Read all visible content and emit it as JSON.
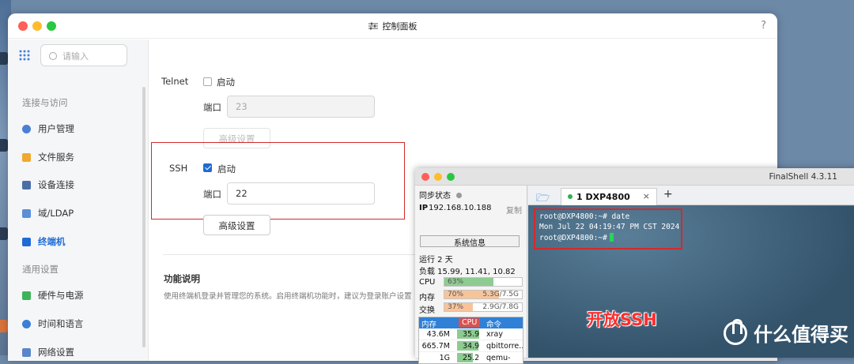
{
  "window": {
    "title": "控制面板",
    "help": "?"
  },
  "sidebar": {
    "search_placeholder": "请输入",
    "section1": "连接与访问",
    "section2": "通用设置",
    "items": [
      {
        "label": "用户管理",
        "icon": "user-icon"
      },
      {
        "label": "文件服务",
        "icon": "folder-icon"
      },
      {
        "label": "设备连接",
        "icon": "device-icon"
      },
      {
        "label": "域/LDAP",
        "icon": "domain-icon"
      },
      {
        "label": "终端机",
        "icon": "terminal-icon",
        "active": true
      },
      {
        "label": "硬件与电源",
        "icon": "battery-icon"
      },
      {
        "label": "时间和语言",
        "icon": "clock-icon"
      },
      {
        "label": "网络设置",
        "icon": "network-icon"
      }
    ]
  },
  "telnet": {
    "label": "Telnet",
    "enable": "启动",
    "enabled": false,
    "port_label": "端口",
    "port": "23",
    "advanced": "高级设置"
  },
  "ssh": {
    "label": "SSH",
    "enable": "启动",
    "enabled": true,
    "port_label": "端口",
    "port": "22",
    "advanced": "高级设置"
  },
  "func": {
    "title": "功能说明",
    "desc": "使用终端机登录并管理您的系统。启用终端机功能时，建议为登录账户设置"
  },
  "finalshell": {
    "app_name": "FinalShell 4.3.11",
    "sync_status": "同步状态",
    "ip_label": "IP",
    "ip": "192.168.10.188",
    "copy": "复制",
    "sysinfo": "系统信息",
    "uptime": "运行 2 天",
    "load": "负载 15.99, 11.41, 10.82",
    "cpu_label": "CPU",
    "cpu_pct": "63%",
    "cpu_value": 0.63,
    "mem_label": "内存",
    "mem_pct": "70%",
    "mem_value": 0.7,
    "mem_detail": "5.3G/7.5G",
    "swap_label": "交换",
    "swap_pct": "37%",
    "swap_value": 0.37,
    "swap_detail": "2.9G/7.8G",
    "proc_headers": [
      "内存",
      "CPU",
      "命令"
    ],
    "processes": [
      {
        "mem": "43.6M",
        "cpu": "35.9",
        "cmd": "xray"
      },
      {
        "mem": "665.7M",
        "cpu": "34.9",
        "cmd": "qbittorre..."
      },
      {
        "mem": "1G",
        "cpu": "25.2",
        "cmd": "qemu-sy..."
      }
    ],
    "tab_label": "1 DXP4800",
    "tab_close": "×",
    "terminal_lines": [
      "root@DXP4800:~# date",
      "Mon Jul 22 04:19:47 PM CST 2024",
      "root@DXP4800:~#"
    ],
    "annotation": "开放SSH"
  },
  "watermark": "什么值得买",
  "colors": {
    "accent": "#1f6bd6",
    "highlight_red": "#d32a2a",
    "cpu_green": "#8ecb91",
    "mem_orange": "#f7c49a"
  }
}
